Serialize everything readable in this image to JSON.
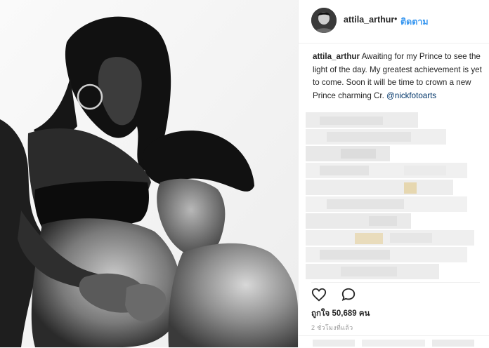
{
  "post": {
    "username": "attila_arthur",
    "separator": "•",
    "follow_label": "ติดตาม",
    "caption_user": "attila_arthur",
    "caption_text": "Awaiting for my Prince to see the light of the day. My greatest achievement is yet to come. Soon it will be time to crown a new Prince charming Cr.",
    "caption_mention": "@nickfotoarts",
    "likes_text": "ถูกใจ 50,689 คน",
    "time_text": "2 ชั่วโมงที่แล้ว"
  },
  "icons": {
    "like": "heart-icon",
    "comment": "comment-bubble-icon",
    "avatar": "profile-avatar"
  },
  "colors": {
    "link": "#3897f0",
    "mention": "#003569",
    "text": "#262626",
    "muted": "#999999",
    "border": "#efefef"
  }
}
